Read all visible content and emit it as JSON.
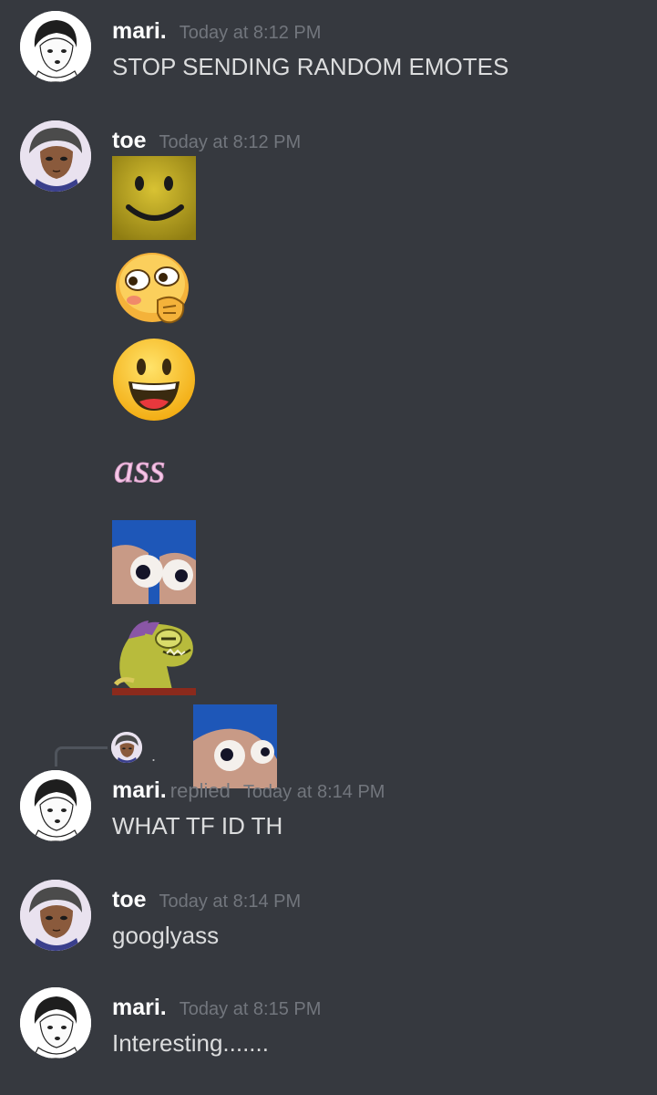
{
  "messages": [
    {
      "author": "mari.",
      "time": "Today at 8:12 PM",
      "text": "STOP SENDING RANDOM EMOTES"
    },
    {
      "author": "toe",
      "time": "Today at 8:12 PM",
      "emotes": [
        "roblox-smile-emote",
        "thinking-blob-emote",
        "grinning-emoji",
        "ass-text-emote",
        "googly-eyes-fingers-emote",
        "fish-monster-emote"
      ],
      "ass_text": "ass"
    },
    {
      "author": "mari.",
      "replied": "replied",
      "time": "Today at 8:14 PM",
      "text": "WHAT TF ID TH",
      "reply_preview": {
        "dot": "."
      }
    },
    {
      "author": "toe",
      "time": "Today at 8:14 PM",
      "text": "googlyass"
    },
    {
      "author": "mari.",
      "time": "Today at 8:15 PM",
      "text": "Interesting......."
    }
  ],
  "colors": {
    "background": "#36393f",
    "author": "#ffffff",
    "timestamp": "#72767d",
    "message_text": "#dcddde"
  }
}
